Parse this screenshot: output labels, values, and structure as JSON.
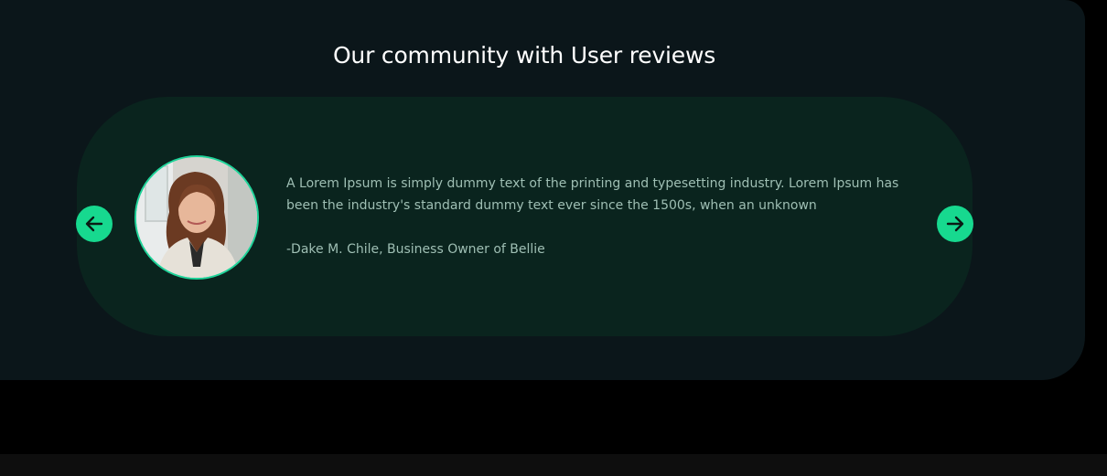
{
  "section": {
    "title": "Our community with User reviews"
  },
  "review": {
    "text": "A Lorem Ipsum is simply dummy text of the printing and typesetting industry. Lorem Ipsum has been the industry's standard dummy text ever since the 1500s, when an unknown",
    "author": "-Dake M. Chile, Business Owner of Bellie",
    "avatar_alt": "reviewer-photo"
  },
  "navigation": {
    "prev_icon": "arrow-left-icon",
    "next_icon": "arrow-right-icon"
  },
  "colors": {
    "page_bg": "#000000",
    "section_bg": "#0b161a",
    "card_bg": "#0a241e",
    "accent": "#17d98f",
    "text": "#9fbfb4",
    "title": "#ffffff"
  }
}
